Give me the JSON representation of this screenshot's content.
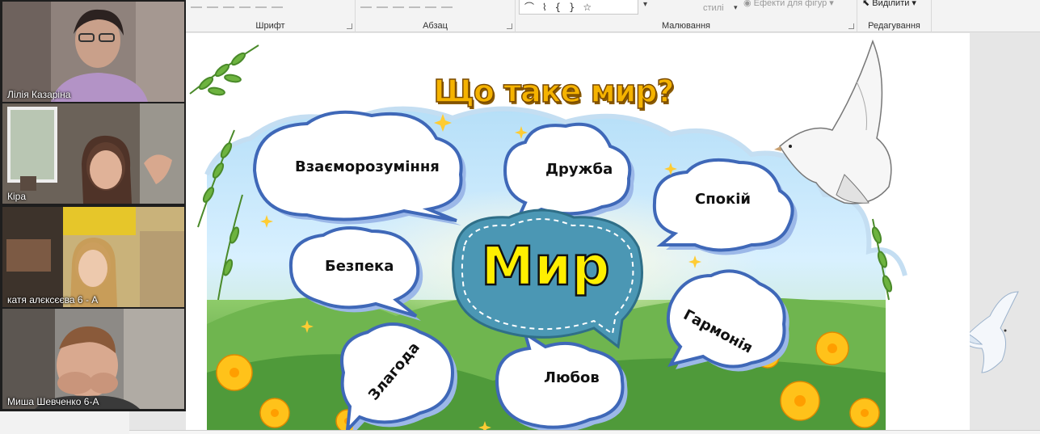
{
  "ribbon": {
    "groups": [
      {
        "label": "Шрифт"
      },
      {
        "label": "Абзац"
      },
      {
        "label": "Малювання"
      },
      {
        "label": "Редагування"
      }
    ],
    "styles_label": "стилі",
    "shape_effects_label": "Ефекти для фігур",
    "select_label": "Виділити",
    "shapes_glyphs": "⌒ ⌇ { } ☆"
  },
  "participants": [
    {
      "name": "Лілія Казаріна",
      "active": false
    },
    {
      "name": "Кіра",
      "active": true
    },
    {
      "name": "катя алєксєєва 6 - А",
      "active": false
    },
    {
      "name": "Миша Шевченко 6-А",
      "active": false
    }
  ],
  "slide": {
    "title": "Що таке мир?",
    "center_word": "Мир",
    "bubbles": [
      {
        "label": "Взаєморозуміння"
      },
      {
        "label": "Дружба"
      },
      {
        "label": "Спокій"
      },
      {
        "label": "Безпека"
      },
      {
        "label": "Гармонія"
      },
      {
        "label": "Злагода"
      },
      {
        "label": "Любов"
      }
    ]
  },
  "colors": {
    "title": "#f5b300",
    "center_word": "#ffef00",
    "center_bubble": "#4b97b4",
    "selection_outline": "#3ad28a"
  }
}
